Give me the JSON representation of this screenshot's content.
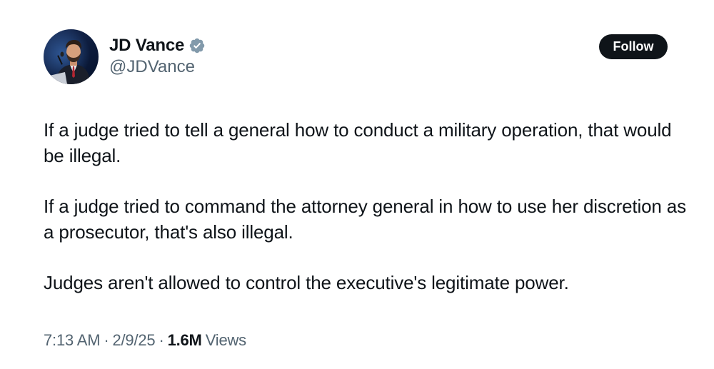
{
  "tweet": {
    "author": {
      "name": "JD Vance",
      "handle": "@JDVance",
      "verified": true,
      "verified_badge_color": "#829aab",
      "avatar_icon": "profile-photo"
    },
    "follow_label": "Follow",
    "paragraphs": [
      "If a judge tried to tell a general how to conduct a military operation, that would be illegal.",
      "If a judge tried to command the attorney general in how to use her discretion as a prosecutor, that's also illegal.",
      "Judges aren't allowed to control the executive's legitimate power."
    ],
    "meta": {
      "time": "7:13 AM",
      "separator": "·",
      "date": "2/9/25",
      "views_count": "1.6M",
      "views_label": "Views"
    }
  },
  "colors": {
    "text_primary": "#0f1419",
    "text_secondary": "#536471",
    "button_bg": "#0f1419",
    "button_text": "#ffffff",
    "background": "#ffffff"
  }
}
